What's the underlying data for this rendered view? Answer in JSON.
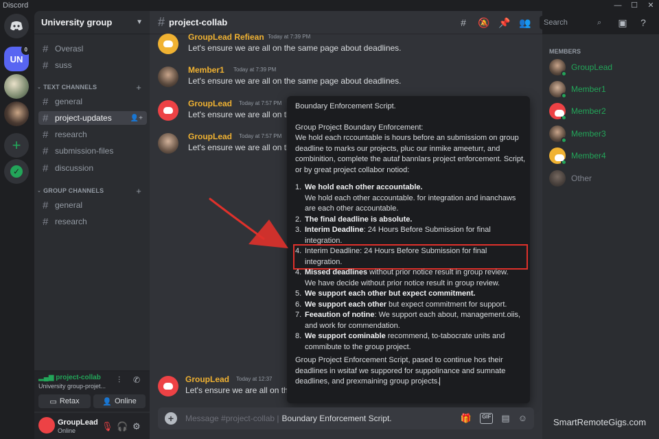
{
  "window": {
    "title": "Discord"
  },
  "servers": {
    "un_label": "UN",
    "un_badge": "0"
  },
  "guild": {
    "name": "University group"
  },
  "channels": {
    "top": [
      {
        "label": "Overasl"
      },
      {
        "label": "suss"
      }
    ],
    "text_category": "TEXT CHANNELS",
    "text": [
      {
        "label": "general"
      },
      {
        "label": "project-updates"
      },
      {
        "label": "research"
      },
      {
        "label": "submission-files"
      },
      {
        "label": "discussion"
      }
    ],
    "group_category": "GROUP CHANNELS",
    "group": [
      {
        "label": "general"
      },
      {
        "label": "research"
      }
    ]
  },
  "voice": {
    "channel": "project-collab",
    "subtitle": "University group-projet...",
    "retax_label": "Retax",
    "online_label": "Online"
  },
  "user": {
    "name": "GroupLead",
    "status": "Online"
  },
  "chat": {
    "channel_name": "project-collab",
    "messages": [
      {
        "author": "GroupLead  Refiean",
        "author_color": "#f0b232",
        "timestamp": "Today at 7:39 PM",
        "text": "Let's ensure we are all on the same page about deadlines."
      },
      {
        "author": "Member1",
        "author_color": "#f0b232",
        "timestamp": "Today at 7:39 PM",
        "text": "Let's ensure we are all on the same page about deadlines."
      },
      {
        "author": "GroupLead",
        "author_color": "#f0b232",
        "timestamp": "Today at 7:57 PM",
        "text": "Let's ensure we are all on the"
      },
      {
        "author": "GroupLead",
        "author_color": "#f0b232",
        "timestamp": "Today at 7:57 PM",
        "text": "Let's ensure we are all on the"
      },
      {
        "author": "GroupLead",
        "author_color": "#f0b232",
        "timestamp": "Today at 12:37",
        "text": "Let's ensure we are all on the"
      }
    ],
    "composer_placeholder": "Message #project-collab | ",
    "composer_text": "Boundary Enforcement Script."
  },
  "script": {
    "title": "Boundary Enforcement Script.",
    "heading": "Group Project Boundary Enforcement:",
    "intro": "We hold each rccountable is hours before an submissiom on group deadline to marks our projects, pluc our inmike ameeturr, and combinition, complete the autaf bannlars project enforcement. Script, or by great project collabor notiod:",
    "items": [
      {
        "num": "1.",
        "bold": "We hold each other accountable.",
        "rest": "",
        "extra": "We hold each other accountable. for integration and inanchaws are each other accountable."
      },
      {
        "num": "2.",
        "bold": "The final deadline is absolute.",
        "rest": "",
        "extra": ""
      },
      {
        "num": "3.",
        "bold": "Interim Deadline",
        "rest": ": 24 Hours Before Submission for final integration.",
        "extra": ""
      },
      {
        "num": "4.",
        "bold": "",
        "rest": "Interim Deadline: 24 Hours Before Submission for final integration.",
        "extra": ""
      },
      {
        "num": "4.",
        "bold": "Missed deadlines",
        "rest": " without prior notice result in group review.",
        "extra": "We have decide without prior notice result in group review."
      },
      {
        "num": "5.",
        "bold": "We support each other but expect commitment.",
        "rest": "",
        "extra": ""
      },
      {
        "num": "6.",
        "bold": "We support each other",
        "rest": " but expect commitment for support.",
        "extra": ""
      },
      {
        "num": "7.",
        "bold": "Feeaution of notine",
        "rest": ": We support each about, management.oiis, and work for commendation.",
        "extra": ""
      },
      {
        "num": "8.",
        "bold": "We support cominable",
        "rest": " recommend, to-tabocrate units and commibute to the group project.",
        "extra": ""
      }
    ],
    "outro": "Group Project Enforcement Script, pased to continue hos their deadlines in wsitaf we suppored for suppolinance and sumnate deadlines, and prexmaining group projects."
  },
  "search": {
    "placeholder": "Search"
  },
  "members": {
    "header": "MEMBERS",
    "list": [
      {
        "name": "GroupLead",
        "online": true
      },
      {
        "name": "Member1",
        "online": true
      },
      {
        "name": "Member2",
        "online": true
      },
      {
        "name": "Member3",
        "online": true
      },
      {
        "name": "Member4",
        "online": true
      },
      {
        "name": "Other",
        "online": false
      }
    ]
  },
  "watermark": "SmartRemoteGigs.com",
  "colors": {
    "accent": "#5865f2",
    "online": "#23a559",
    "author": "#f0b232",
    "highlight": "#e0312b"
  }
}
